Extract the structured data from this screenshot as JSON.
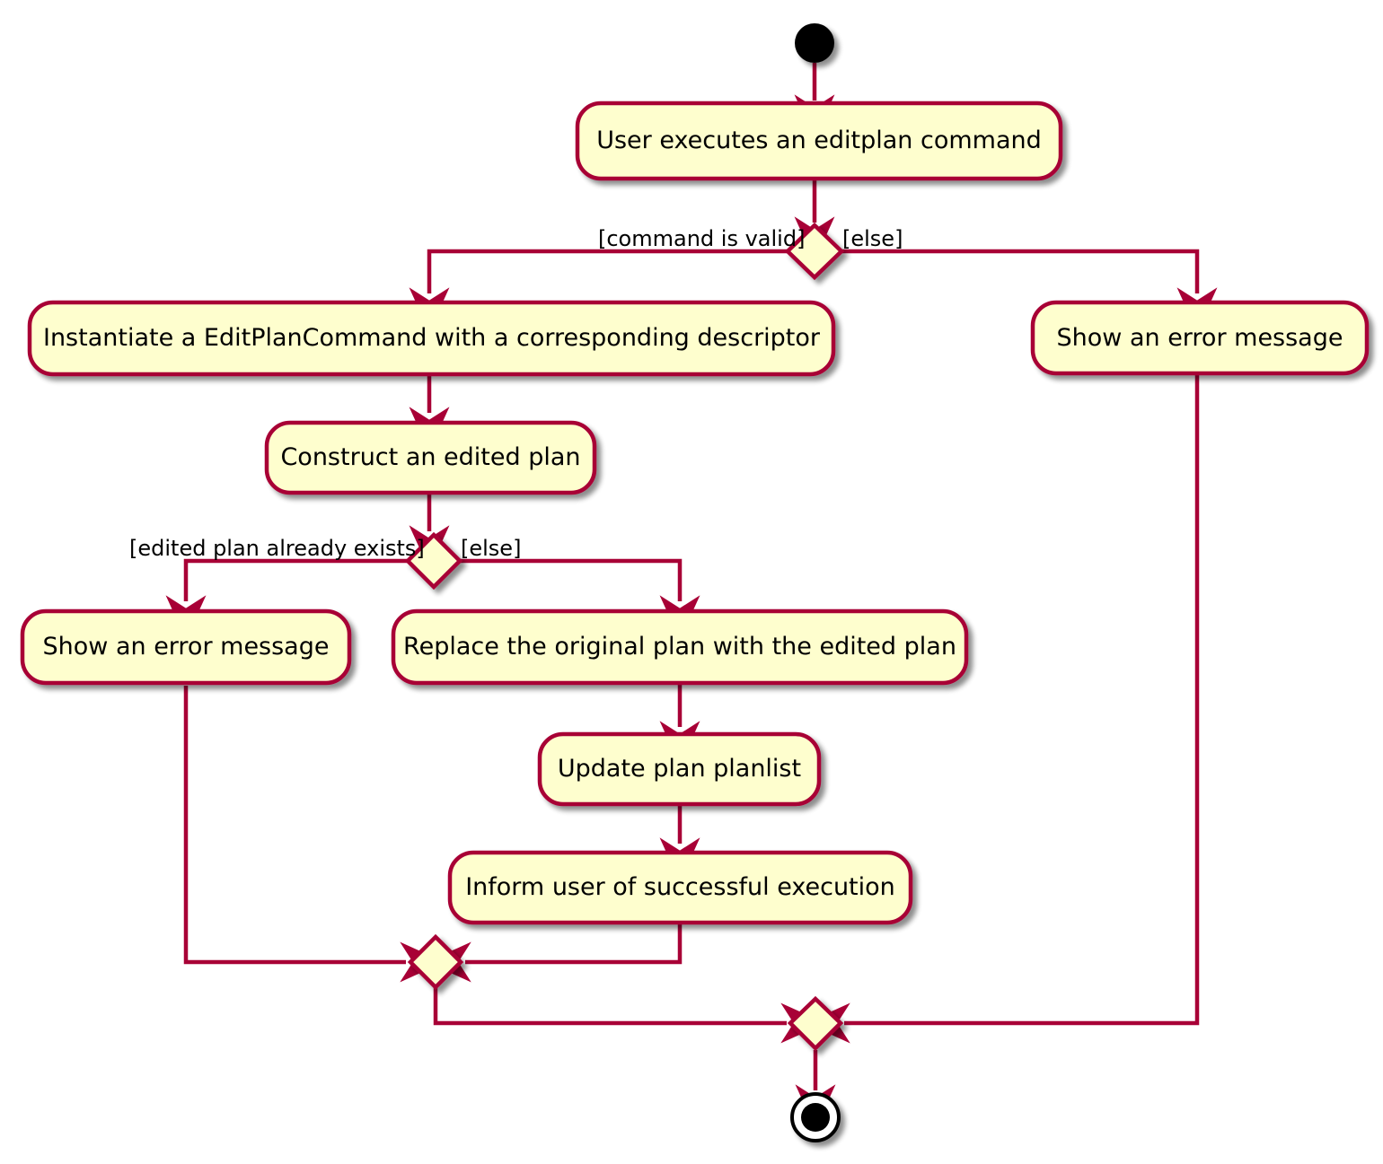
{
  "diagram": {
    "type": "uml-activity-diagram",
    "colors": {
      "node_fill": "#FEFECE",
      "node_border": "#A80036",
      "edge": "#A80036",
      "text": "#000000",
      "background": "#FFFFFF",
      "start_node": "#000000",
      "end_node_ring": "#000000",
      "shadow": "#808080"
    },
    "start_node": {
      "name": "start"
    },
    "end_node": {
      "name": "end"
    },
    "activities": [
      {
        "id": "a1",
        "label": "User executes an editplan command"
      },
      {
        "id": "a2",
        "label": "Instantiate a EditPlanCommand with a corresponding descriptor"
      },
      {
        "id": "a3",
        "label": "Construct an edited plan"
      },
      {
        "id": "a4",
        "label": "Show an error message"
      },
      {
        "id": "a5",
        "label": "Show an error message"
      },
      {
        "id": "a6",
        "label": "Replace the original plan with the edited plan"
      },
      {
        "id": "a7",
        "label": "Update plan planlist"
      },
      {
        "id": "a8",
        "label": "Inform user of successful execution"
      }
    ],
    "decisions": [
      {
        "id": "d1",
        "guard_true": "[command is valid]",
        "guard_false": "[else]"
      },
      {
        "id": "d2",
        "guard_true": "[edited plan already exists]",
        "guard_false": "[else]"
      }
    ],
    "merges": [
      {
        "id": "m1"
      },
      {
        "id": "m2"
      }
    ]
  }
}
